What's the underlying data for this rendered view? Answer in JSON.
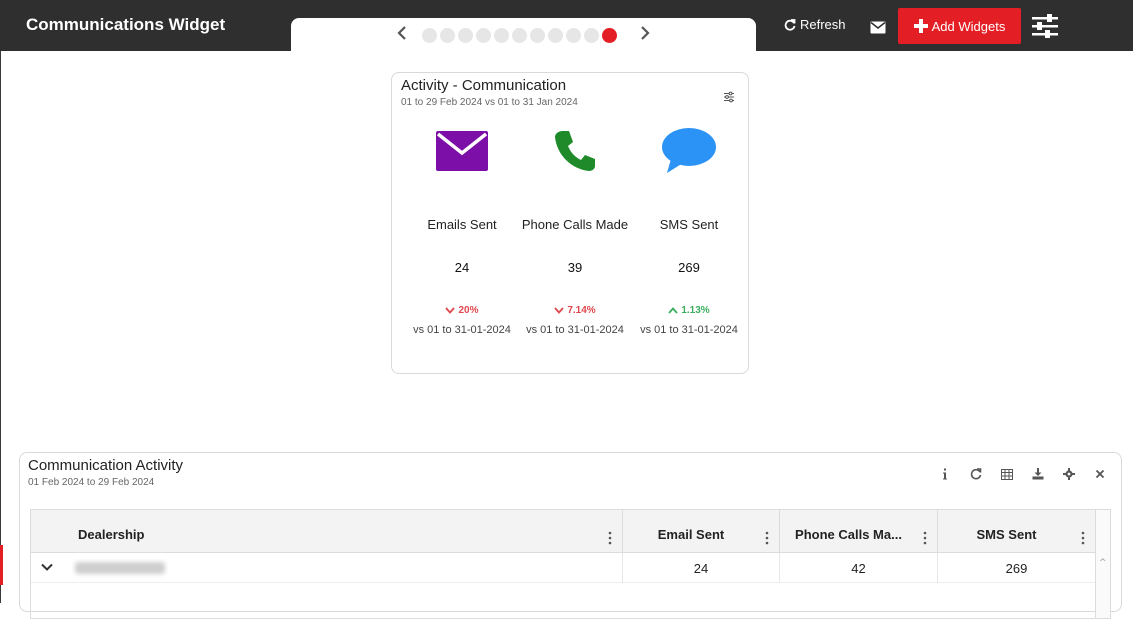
{
  "app": {
    "title": "Communications Widget",
    "refresh_label": "Refresh",
    "add_widgets_label": "Add Widgets",
    "accent_color": "#e31e24",
    "topbar_color": "#2f2f2f"
  },
  "pager": {
    "total_pages": 11,
    "active_page": 11
  },
  "comm_card": {
    "title": "Activity - Communication",
    "subtitle": "01 to 29 Feb 2024 vs 01 to 31 Jan 2024",
    "metrics": [
      {
        "icon": "envelope-icon",
        "label": "Emails Sent",
        "value": "24",
        "delta": "20%",
        "direction": "down",
        "compare": "vs 01 to 31-01-2024",
        "color": "#7b0fa8"
      },
      {
        "icon": "phone-icon",
        "label": "Phone Calls Made",
        "value": "39",
        "delta": "7.14%",
        "direction": "down",
        "compare": "vs 01 to 31-01-2024",
        "color": "#1e8a2a"
      },
      {
        "icon": "chat-bubble-icon",
        "label": "SMS Sent",
        "value": "269",
        "delta": "1.13%",
        "direction": "up",
        "compare": "vs 01 to 31-01-2024",
        "color": "#2b93f5"
      }
    ]
  },
  "activity_panel": {
    "title": "Communication Activity",
    "subtitle": "01 Feb 2024 to 29 Feb 2024",
    "columns": [
      "Dealership",
      "Email Sent",
      "Phone Calls Ma...",
      "SMS Sent"
    ],
    "rows": [
      {
        "dealership": "",
        "email_sent": "24",
        "phone_calls": "42",
        "sms_sent": "269"
      }
    ]
  }
}
